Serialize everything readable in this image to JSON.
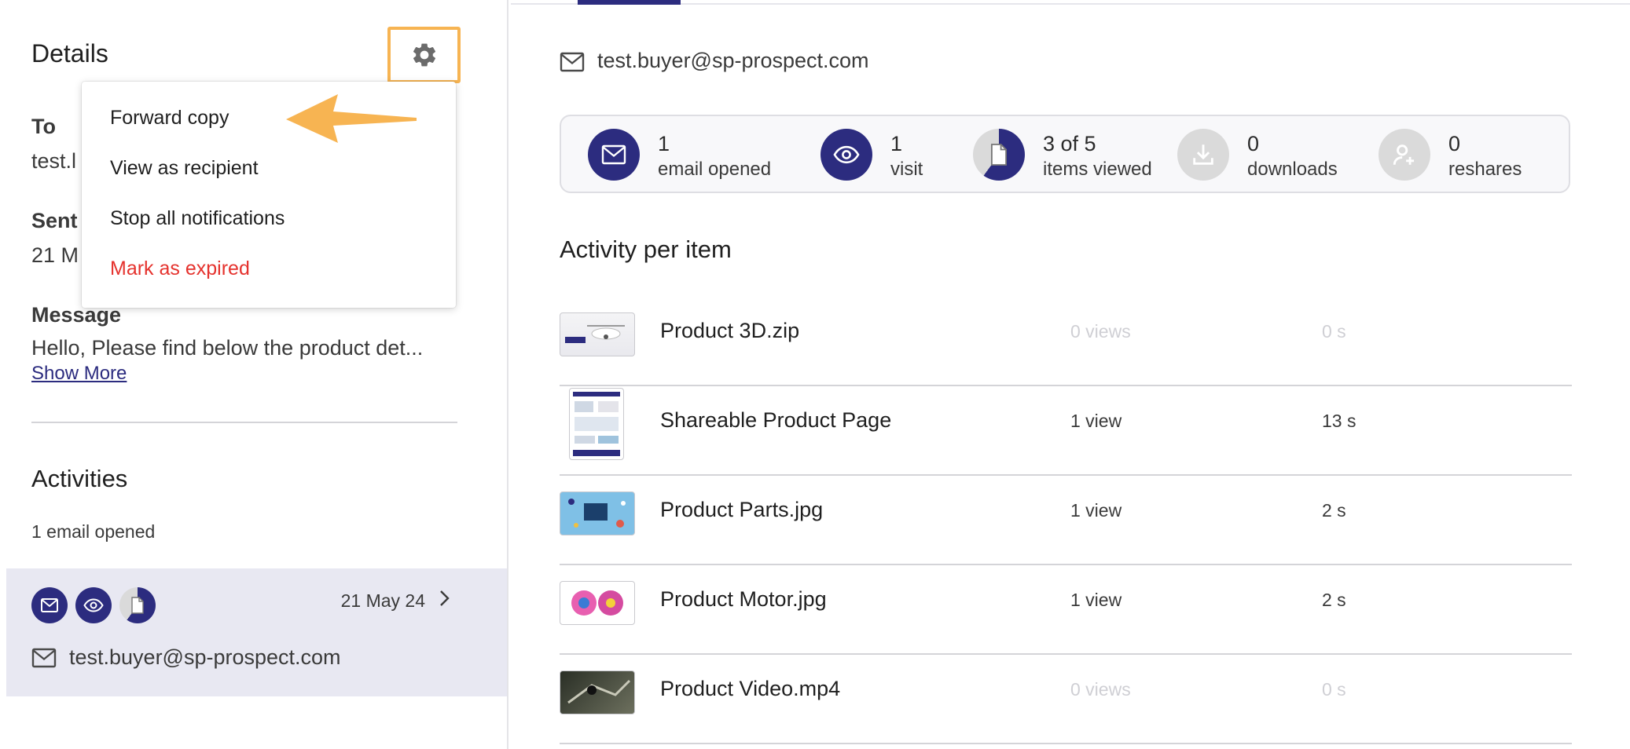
{
  "details": {
    "title": "Details",
    "to_label": "To",
    "to_value_visible": "test.l",
    "sent_label": "Sent",
    "sent_value_visible": "21 M",
    "message_label": "Message",
    "message_text": "Hello, Please find below the product det...",
    "show_more": "Show More"
  },
  "menu": {
    "items": [
      {
        "label": "Forward copy",
        "danger": false
      },
      {
        "label": "View as recipient",
        "danger": false
      },
      {
        "label": "Stop all notifications",
        "danger": false
      },
      {
        "label": "Mark as expired",
        "danger": true
      }
    ]
  },
  "activities": {
    "title": "Activities",
    "count_text": "1 email opened",
    "card": {
      "date": "21 May 24",
      "email": "test.buyer@sp-prospect.com",
      "icons": [
        "email-icon",
        "eye-icon",
        "document-progress-icon"
      ]
    }
  },
  "recipient": {
    "email": "test.buyer@sp-prospect.com"
  },
  "stats": [
    {
      "value": "1",
      "label": "email opened",
      "icon": "email-icon",
      "active": true
    },
    {
      "value": "1",
      "label": "visit",
      "icon": "eye-icon",
      "active": true
    },
    {
      "value": "3 of 5",
      "label": "items viewed",
      "icon": "document-progress-icon",
      "active": true,
      "progress": 0.6
    },
    {
      "value": "0",
      "label": "downloads",
      "icon": "download-icon",
      "active": false
    },
    {
      "value": "0",
      "label": "reshares",
      "icon": "add-user-icon",
      "active": false
    }
  ],
  "activity_per_item": {
    "title": "Activity per item",
    "items": [
      {
        "name": "Product 3D.zip",
        "views": "0 views",
        "time": "0 s",
        "active": false
      },
      {
        "name": "Shareable Product Page",
        "views": "1 view",
        "time": "13 s",
        "active": true
      },
      {
        "name": "Product Parts.jpg",
        "views": "1 view",
        "time": "2 s",
        "active": true
      },
      {
        "name": "Product Motor.jpg",
        "views": "1 view",
        "time": "2 s",
        "active": true
      },
      {
        "name": "Product Video.mp4",
        "views": "0 views",
        "time": "0 s",
        "active": false
      }
    ]
  },
  "colors": {
    "accent": "#2c2c7f",
    "highlight": "#f7b452",
    "danger": "#e5322d",
    "card_bg": "#e8e8f2"
  }
}
